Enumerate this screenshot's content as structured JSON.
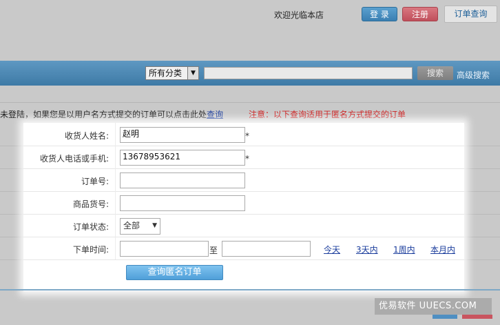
{
  "header": {
    "welcome": "欢迎光临本店",
    "login_label": "登 录",
    "register_label": "注册",
    "order_query_label": "订单查询"
  },
  "search": {
    "category_selected": "所有分类",
    "search_button": "搜索",
    "advanced_search": "高级搜索"
  },
  "notice": {
    "left_text": "未登陆，如果您是以用户名方式提交的订单可以点击此处",
    "left_link": "查询",
    "right_text": "注意：以下查询适用于匿名方式提交的订单"
  },
  "form": {
    "receiver_name_label": "收货人姓名:",
    "receiver_name_value": "赵明",
    "receiver_phone_label": "收货人电话或手机:",
    "receiver_phone_value": "13678953621",
    "required_mark": "*",
    "order_no_label": "订单号:",
    "product_sku_label": "商品货号:",
    "order_status_label": "订单状态:",
    "order_status_selected": "全部",
    "order_time_label": "下单时间:",
    "to_label": "至",
    "quick_ranges": [
      "今天",
      "3天内",
      "1周内",
      "本月内"
    ],
    "submit_label": "查询匿名订单"
  },
  "watermark": "优易软件 UUECS.COM",
  "icons": {
    "dropdown": "chevron-down-icon"
  }
}
